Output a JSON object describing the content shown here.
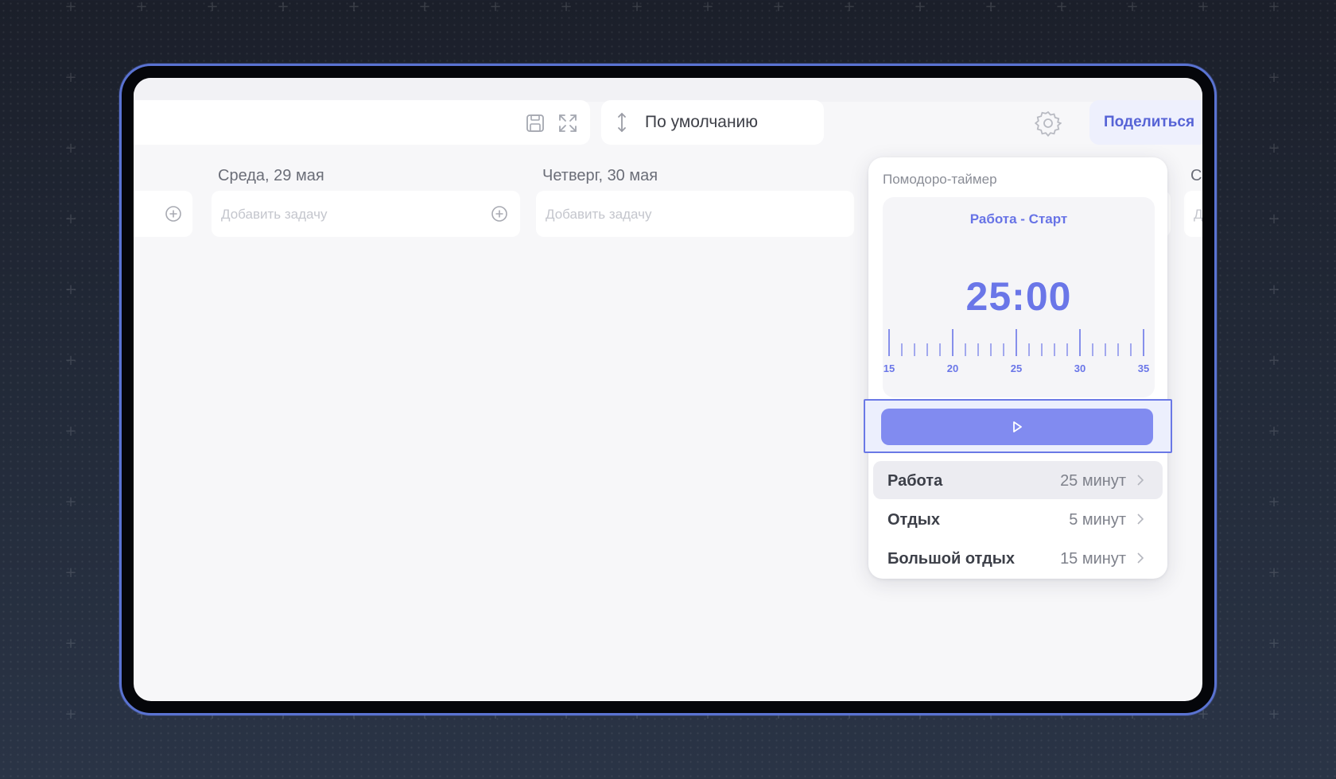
{
  "toolbar": {
    "sort_label": "По умолчанию",
    "share_label": "Поделиться"
  },
  "days": [
    {
      "title": "Среда, 29 мая",
      "placeholder": "Добавить задачу"
    },
    {
      "title": "Четверг, 30 мая",
      "placeholder": "Добавить задачу"
    },
    {
      "title": "С",
      "placeholder": "Д"
    }
  ],
  "pomodoro": {
    "title": "Помодоро-таймер",
    "mode_label": "Работа - Старт",
    "time": "25:00",
    "ruler_labels": [
      "15",
      "20",
      "25",
      "30",
      "35"
    ],
    "options": [
      {
        "name": "Работа",
        "value": "25 минут",
        "active": true
      },
      {
        "name": "Отдых",
        "value": "5 минут",
        "active": false
      },
      {
        "name": "Большой отдых",
        "value": "15 минут",
        "active": false
      }
    ]
  },
  "icons": {
    "save": "save-icon",
    "fullscreen": "fullscreen-icon",
    "sort": "sort-arrow-icon",
    "settings": "gear-icon",
    "add": "plus-circle-icon",
    "play": "play-icon",
    "chevron": "chevron-right-icon"
  },
  "colors": {
    "accent": "#6a76e8",
    "start_button": "#818bf0",
    "device_frame": "#5a73d2"
  }
}
